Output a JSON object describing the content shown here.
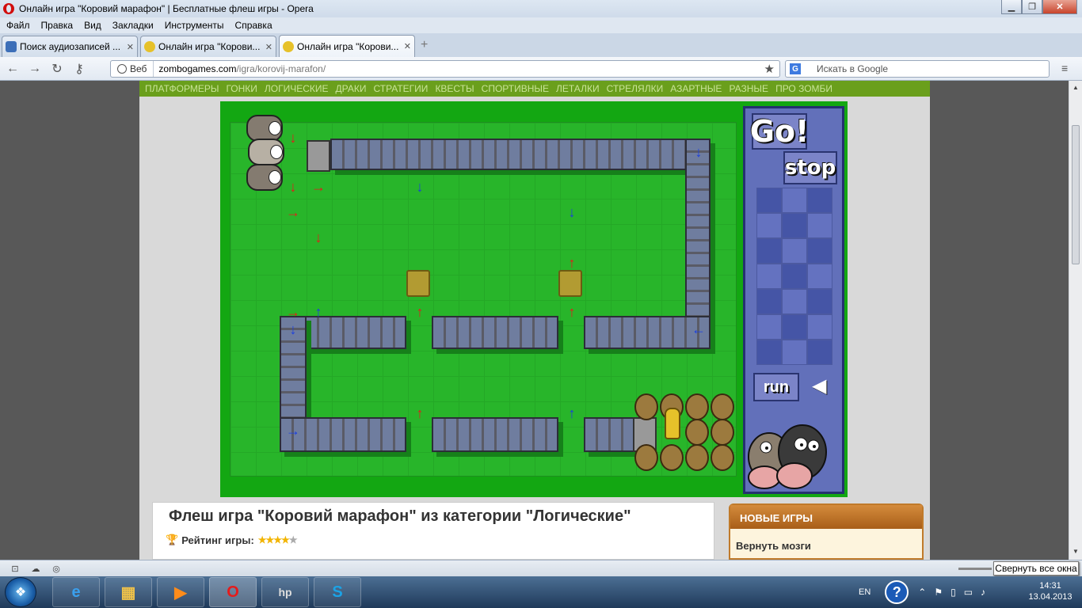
{
  "window": {
    "title": "Онлайн игра \"Коровий марафон\" | Бесплатные флеш игры - Opera",
    "min": "▁",
    "max": "❐",
    "close": "✕"
  },
  "menu": [
    "Файл",
    "Правка",
    "Вид",
    "Закладки",
    "Инструменты",
    "Справка"
  ],
  "tabs": [
    {
      "label": "Поиск аудиозаписей ...",
      "close": "✕",
      "icon_color": "#3d6fb8"
    },
    {
      "label": "Онлайн игра \"Корови...",
      "close": "✕",
      "icon_color": "#e6c12a"
    },
    {
      "label": "Онлайн игра \"Корови...",
      "close": "✕",
      "icon_color": "#e6c12a"
    }
  ],
  "newtab": "+",
  "nav": {
    "back": "←",
    "forward": "→",
    "reload": "↻",
    "key": "⚷"
  },
  "address": {
    "chip": "Веб",
    "domain": "zombogames.com",
    "path": "/igra/korovij-marafon/",
    "star": "★"
  },
  "search": {
    "placeholder": "Искать в Google",
    "engine": "G"
  },
  "categories": [
    "ПЛАТФОРМЕРЫ",
    "ГОНКИ",
    "ЛОГИЧЕСКИЕ",
    "ДРАКИ",
    "СТРАТЕГИИ",
    "КВЕСТЫ",
    "СПОРТИВНЫЕ",
    "ЛЕТАЛКИ",
    "СТРЕЛЯЛКИ",
    "АЗАРТНЫЕ",
    "РАЗНЫЕ",
    "ПРО ЗОМБИ"
  ],
  "game": {
    "go": "Go!",
    "stop": "stop",
    "run": "run",
    "speaker": "◀"
  },
  "info": {
    "title": "Флеш игра \"Коровий марафон\" из категории \"Логические\"",
    "rating_label": "Рейтинг игры:",
    "stars_filled": 4,
    "stars_total": 5
  },
  "sidebox": {
    "header": "НОВЫЕ ИГРЫ",
    "item": "Вернуть мозги"
  },
  "statusbar": {
    "tooltip": "Свернуть все окна"
  },
  "tray": {
    "lang": "EN",
    "help": "?",
    "time": "14:31",
    "date": "13.04.2013"
  },
  "colors": {
    "opera_red": "#d10d0d",
    "nav_green": "#6a9f1c",
    "field_green": "#28b52a",
    "panel_blue": "#6270ba"
  }
}
